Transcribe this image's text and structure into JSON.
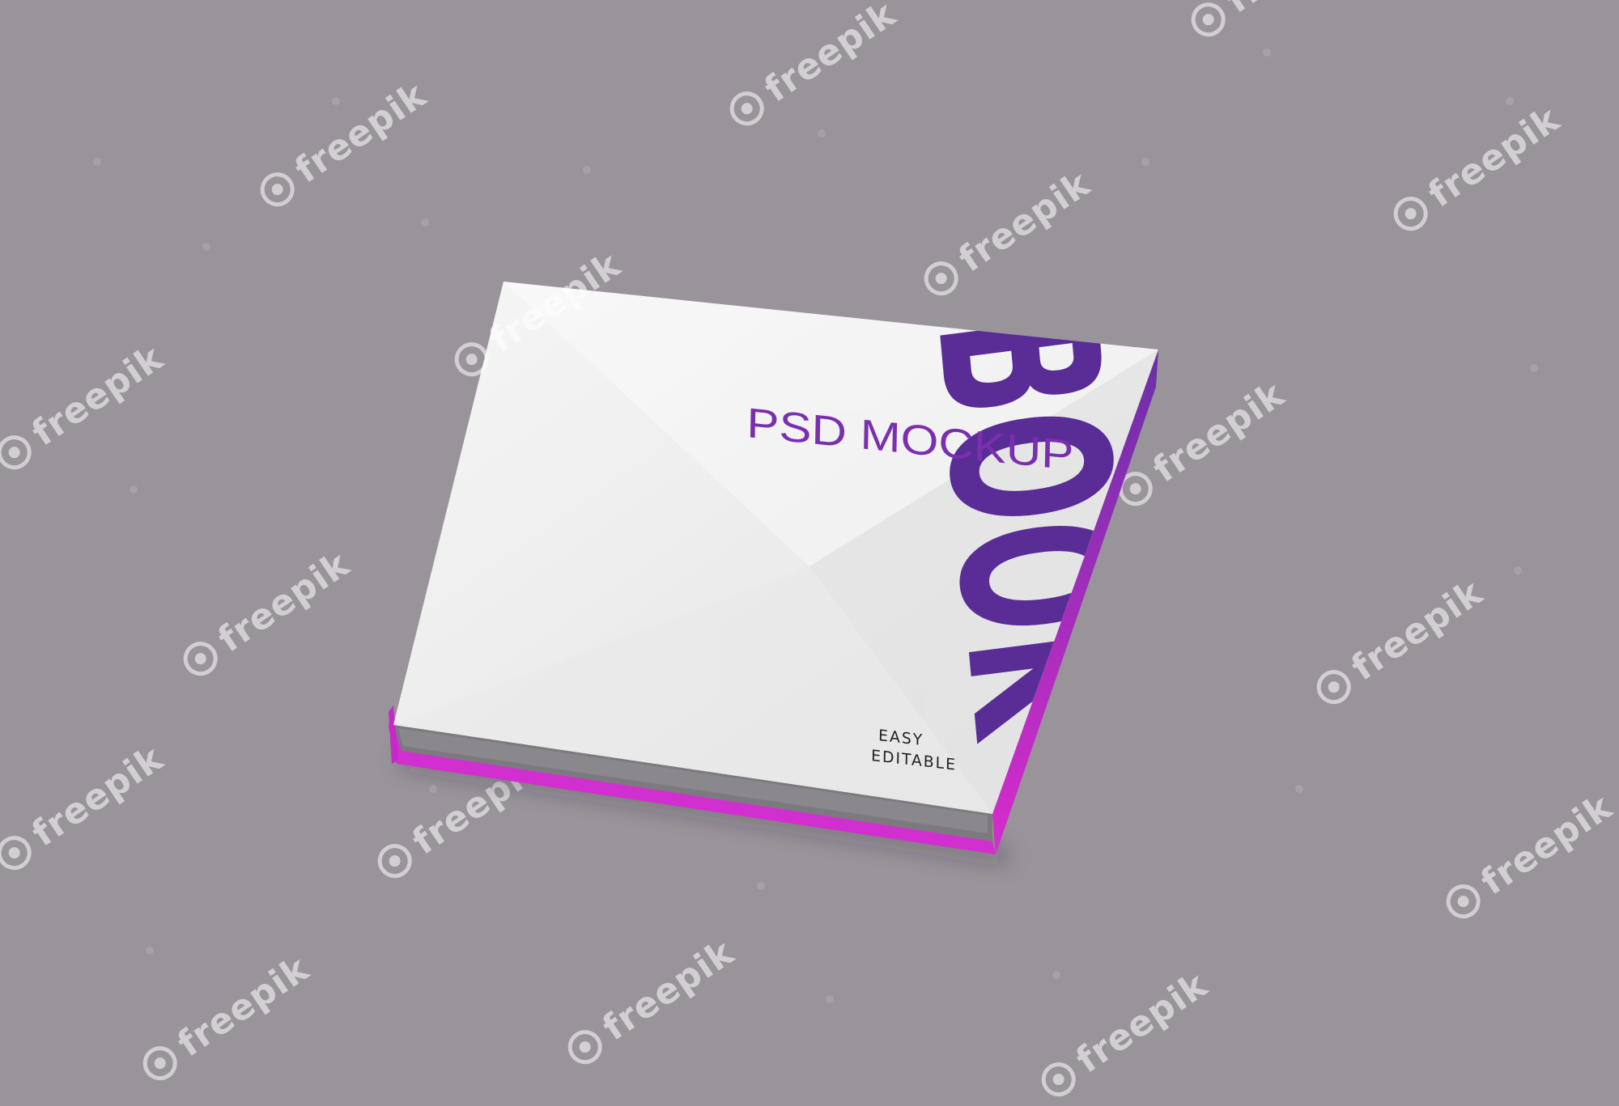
{
  "scene": {
    "background_color": "#99949a",
    "object": "hardcover book mockup"
  },
  "cover": {
    "big_title": "BOOK",
    "subtitle": "PSD MOCKUP",
    "badge_line1": "EASY",
    "badge_line2": "EDITABLE",
    "gradient_top_color": "#5a2d96",
    "gradient_bottom_color": "#e02ad2",
    "cover_color": "#f2f2f2",
    "edge_color": "#d12fcf"
  },
  "watermark": {
    "text": "freepik",
    "icon": "freepik-logo-icon"
  }
}
